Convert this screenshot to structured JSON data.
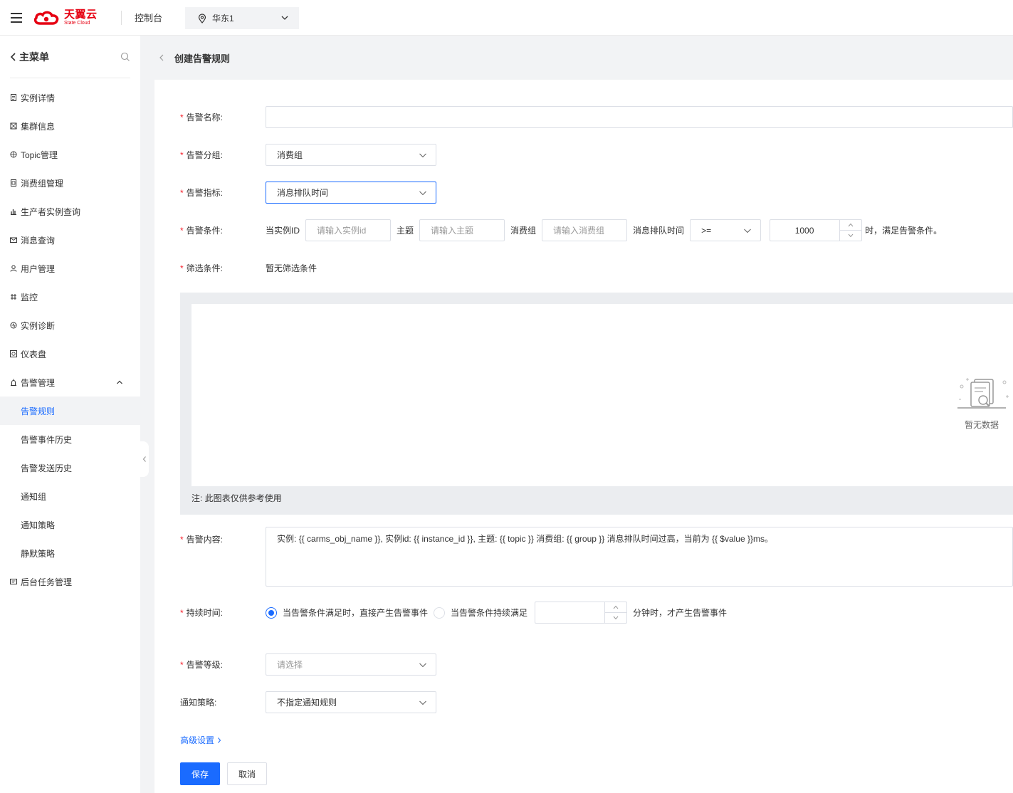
{
  "header": {
    "logo_cn": "天翼云",
    "logo_en": "State Cloud",
    "console": "控制台",
    "region": "华东1"
  },
  "sidebar": {
    "title": "主菜单",
    "items": [
      {
        "label": "实例详情",
        "icon": "file-icon"
      },
      {
        "label": "集群信息",
        "icon": "cluster-icon"
      },
      {
        "label": "Topic管理",
        "icon": "grid-icon"
      },
      {
        "label": "消费组管理",
        "icon": "stack-icon"
      },
      {
        "label": "生产者实例查询",
        "icon": "bar-chart-icon"
      },
      {
        "label": "消息查询",
        "icon": "mail-icon"
      },
      {
        "label": "用户管理",
        "icon": "user-icon"
      },
      {
        "label": "监控",
        "icon": "monitor-icon"
      },
      {
        "label": "实例诊断",
        "icon": "diagnose-icon"
      },
      {
        "label": "仪表盘",
        "icon": "dashboard-icon"
      },
      {
        "label": "告警管理",
        "icon": "alarm-icon"
      },
      {
        "label": "告警规则",
        "icon": ""
      },
      {
        "label": "告警事件历史",
        "icon": ""
      },
      {
        "label": "告警发送历史",
        "icon": ""
      },
      {
        "label": "通知组",
        "icon": ""
      },
      {
        "label": "通知策略",
        "icon": ""
      },
      {
        "label": "静默策略",
        "icon": ""
      },
      {
        "label": "后台任务管理",
        "icon": "task-icon"
      }
    ]
  },
  "page": {
    "title": "创建告警规则"
  },
  "form": {
    "name": {
      "label": "告警名称:",
      "value": ""
    },
    "group": {
      "label": "告警分组:",
      "value": "消费组"
    },
    "metric": {
      "label": "告警指标:",
      "value": "消息排队时间"
    },
    "condition": {
      "label": "告警条件:",
      "t_instance": "当实例ID",
      "ph_instance": "请输入实例id",
      "t_topic": "主题",
      "ph_topic": "请输入主题",
      "t_group": "消费组",
      "ph_group": "请输入消费组",
      "t_metric": "消息排队时间",
      "operator": ">=",
      "threshold": "1000",
      "t_suffix": "时，满足告警条件。"
    },
    "filter": {
      "label": "筛选条件:",
      "value": "暂无筛选条件"
    },
    "chart": {
      "empty": "暂无数据",
      "note": "注: 此图表仅供参考使用"
    },
    "content": {
      "label": "告警内容:",
      "value": "实例: {{ carms_obj_name }}, 实例id: {{ instance_id }}, 主题: {{ topic }} 消费组: {{ group }} 消息排队时间过高，当前为 {{ $value }}ms。"
    },
    "duration": {
      "label": "持续时间:",
      "opt1": "当告警条件满足时，直接产生告警事件",
      "opt2": "当告警条件持续满足",
      "minutes": "",
      "suffix": "分钟时，才产生告警事件"
    },
    "level": {
      "label": "告警等级:",
      "placeholder": "请选择"
    },
    "policy": {
      "label": "通知策略:",
      "value": "不指定通知规则"
    },
    "advanced": "高级设置",
    "save": "保存",
    "cancel": "取消"
  },
  "colors": {
    "accent": "#1a6bff",
    "brand": "#e60012",
    "required": "#f5222d"
  }
}
